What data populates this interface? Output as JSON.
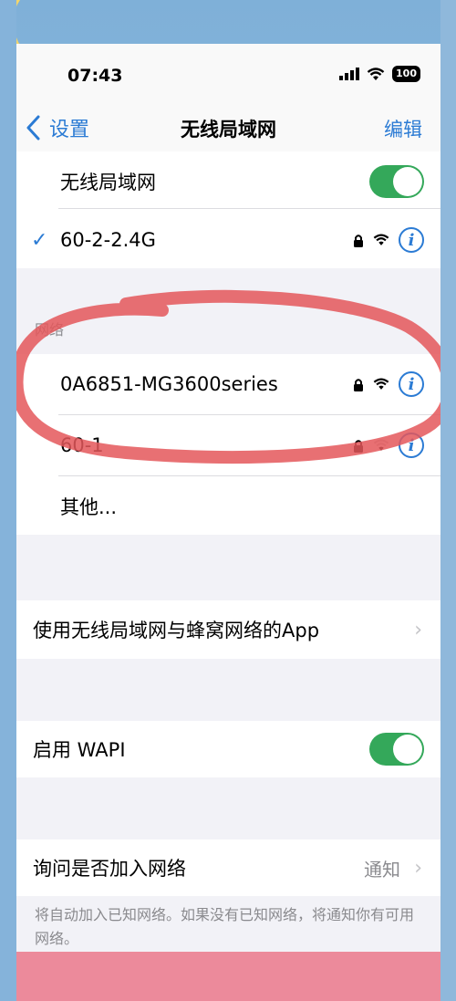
{
  "status": {
    "time": "07:43",
    "battery": "100"
  },
  "nav": {
    "back_label": "设置",
    "title": "无线局域网",
    "edit_label": "编辑"
  },
  "wifi_toggle": {
    "label": "无线局域网",
    "on": true
  },
  "connected": {
    "name": "60-2-2.4G",
    "check": "✓"
  },
  "networks_header": "网络",
  "networks": [
    {
      "name": "0A6851-MG3600series"
    },
    {
      "name": "60-1"
    }
  ],
  "other_label": "其他...",
  "apps_row": {
    "label": "使用无线局域网与蜂窝网络的App"
  },
  "wapi": {
    "label": "启用 WAPI",
    "on": true
  },
  "ask_join": {
    "label": "询问是否加入网络",
    "value": "通知"
  },
  "footnote": "将自动加入已知网络。如果没有已知网络，将通知你有可用网络。",
  "colors": {
    "accent": "#2b7bd4",
    "toggle_on": "#34a85a",
    "annotation": "#e4575a"
  }
}
